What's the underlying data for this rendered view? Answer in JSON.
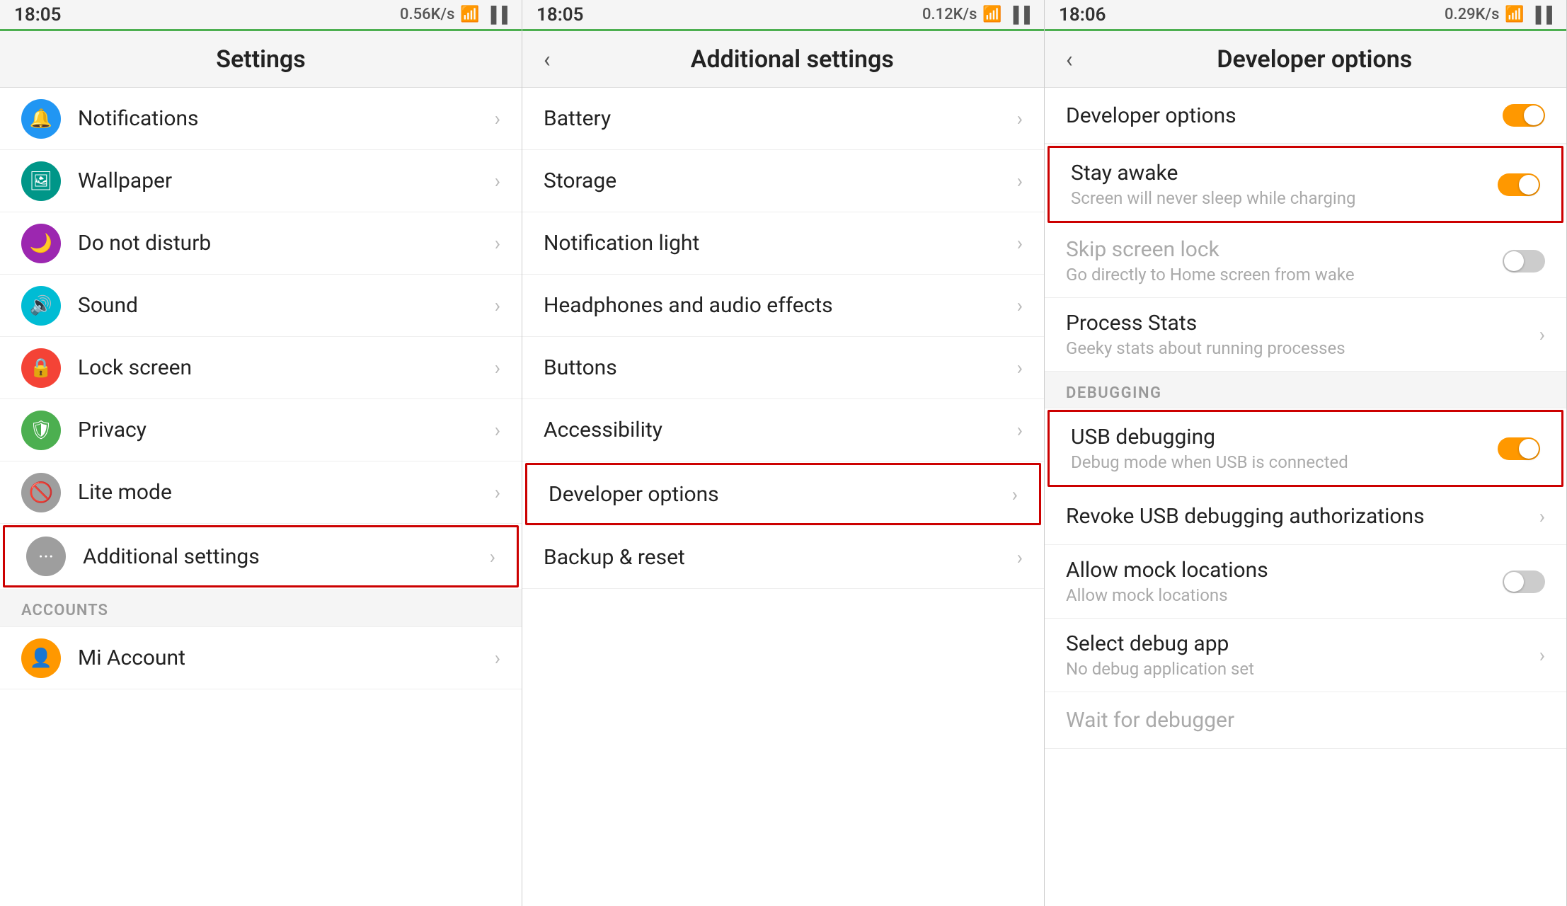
{
  "panels": [
    {
      "id": "settings",
      "statusBar": {
        "time": "18:05",
        "networkSpeed": "0.56K/s",
        "icons": [
          "📶",
          "📶",
          "📶"
        ]
      },
      "topBar": {
        "title": "Settings",
        "hasBack": false
      },
      "sections": [
        {
          "type": "list",
          "items": [
            {
              "icon": "🔔",
              "iconClass": "blue",
              "label": "Notifications",
              "highlighted": false
            },
            {
              "icon": "🖼",
              "iconClass": "teal",
              "label": "Wallpaper",
              "highlighted": false
            },
            {
              "icon": "🌙",
              "iconClass": "purple",
              "label": "Do not disturb",
              "highlighted": false
            },
            {
              "icon": "🔊",
              "iconClass": "cyan",
              "label": "Sound",
              "highlighted": false
            },
            {
              "icon": "🔒",
              "iconClass": "orange-red",
              "label": "Lock screen",
              "highlighted": false
            },
            {
              "icon": "🛡",
              "iconClass": "green",
              "label": "Privacy",
              "highlighted": false
            },
            {
              "icon": "🚫",
              "iconClass": "gray",
              "label": "Lite mode",
              "highlighted": false
            },
            {
              "icon": "⋯",
              "iconClass": "gray",
              "label": "Additional settings",
              "highlighted": true
            }
          ]
        },
        {
          "type": "section-header",
          "label": "ACCOUNTS"
        },
        {
          "type": "list",
          "items": [
            {
              "icon": "👤",
              "iconClass": "orange",
              "label": "Mi Account",
              "highlighted": false
            }
          ]
        }
      ]
    },
    {
      "id": "additional-settings",
      "statusBar": {
        "time": "18:05",
        "networkSpeed": "0.12K/s"
      },
      "topBar": {
        "title": "Additional settings",
        "hasBack": true
      },
      "items": [
        {
          "label": "Battery",
          "hasChevron": true,
          "highlighted": false
        },
        {
          "label": "Storage",
          "hasChevron": true,
          "highlighted": false
        },
        {
          "label": "Notification light",
          "hasChevron": true,
          "highlighted": false
        },
        {
          "label": "Headphones and audio effects",
          "hasChevron": true,
          "highlighted": false
        },
        {
          "label": "Buttons",
          "hasChevron": true,
          "highlighted": false
        },
        {
          "label": "Accessibility",
          "hasChevron": true,
          "highlighted": false
        },
        {
          "label": "Developer options",
          "hasChevron": true,
          "highlighted": true
        },
        {
          "label": "Backup & reset",
          "hasChevron": true,
          "highlighted": false
        }
      ]
    },
    {
      "id": "developer-options",
      "statusBar": {
        "time": "18:06",
        "networkSpeed": "0.29K/s"
      },
      "topBar": {
        "title": "Developer options",
        "hasBack": true
      },
      "devToggleLabel": "Developer options",
      "devToggleOn": true,
      "items": [
        {
          "title": "Stay awake",
          "subtitle": "Screen will never sleep while charging",
          "type": "toggle",
          "toggleOn": true,
          "highlighted": true,
          "disabled": false
        },
        {
          "title": "Skip screen lock",
          "subtitle": "Go directly to Home screen from wake",
          "type": "toggle",
          "toggleOn": false,
          "highlighted": false,
          "disabled": true
        },
        {
          "title": "Process Stats",
          "subtitle": "Geeky stats about running processes",
          "type": "chevron",
          "highlighted": false,
          "disabled": false
        }
      ],
      "sections": [
        {
          "label": "DEBUGGING",
          "items": [
            {
              "title": "USB debugging",
              "subtitle": "Debug mode when USB is connected",
              "type": "toggle",
              "toggleOn": true,
              "highlighted": true,
              "disabled": false
            },
            {
              "title": "Revoke USB debugging authorizations",
              "subtitle": "",
              "type": "chevron",
              "highlighted": false,
              "disabled": false
            },
            {
              "title": "Allow mock locations",
              "subtitle": "Allow mock locations",
              "type": "toggle",
              "toggleOn": false,
              "highlighted": false,
              "disabled": false
            },
            {
              "title": "Select debug app",
              "subtitle": "No debug application set",
              "type": "chevron",
              "highlighted": false,
              "disabled": false
            },
            {
              "title": "Wait for debugger",
              "subtitle": "",
              "type": "text-only",
              "highlighted": false,
              "disabled": true
            }
          ]
        }
      ]
    }
  ]
}
